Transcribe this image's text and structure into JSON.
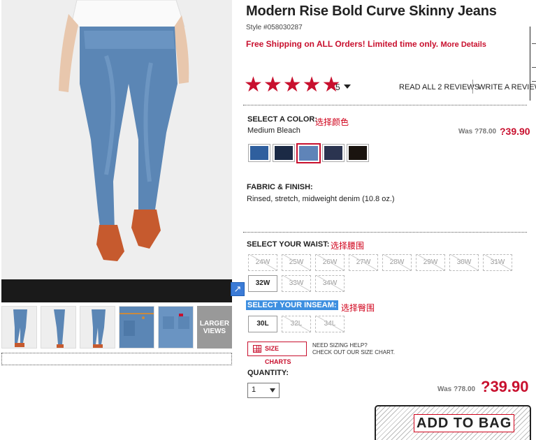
{
  "product": {
    "title": "Modern Rise Bold Curve Skinny Jeans",
    "style": "Style #058030287",
    "shipping": "Free Shipping on ALL Orders! Limited time only.",
    "shipping_more": "More Details"
  },
  "rating": {
    "stars": "★★★★★",
    "count": "5",
    "read_all": "READ ALL 2 REVIEWS",
    "write": "WRITE A REVIEW"
  },
  "color": {
    "label": "SELECT A COLOR:",
    "annotation": "选择颜色",
    "selected": "Medium Bleach",
    "was": "Was ?78.00",
    "price": "?39.90",
    "swatches": [
      "#2f5f9e",
      "#1b2a45",
      "#5f84b8",
      "#2b3450",
      "#1a140f"
    ]
  },
  "fabric": {
    "label": "FABRIC & FINISH:",
    "text": "Rinsed, stretch, midweight denim (10.8 oz.)"
  },
  "waist": {
    "label": "SELECT YOUR WAIST:",
    "annotation": "选择腰围",
    "sizes": [
      "24W",
      "25W",
      "26W",
      "27W",
      "28W",
      "29W",
      "30W",
      "31W",
      "32W",
      "33W",
      "34W"
    ]
  },
  "inseam": {
    "label": "SELECT YOUR INSEAM:",
    "annotation": "选择臀围",
    "sizes": [
      "30L",
      "32L",
      "34L"
    ]
  },
  "size_help": {
    "button": "SIZE CHARTS",
    "line1": "NEED SIZING HELP?",
    "line2": "CHECK OUT OUR SIZE CHART."
  },
  "quantity": {
    "label": "QUANTITY:",
    "value": "1",
    "was": "Was ?78.00",
    "price": "?39.90"
  },
  "gallery": {
    "larger_views": "LARGER VIEWS"
  },
  "cta": {
    "add_to_bag": "ADD TO BAG"
  }
}
